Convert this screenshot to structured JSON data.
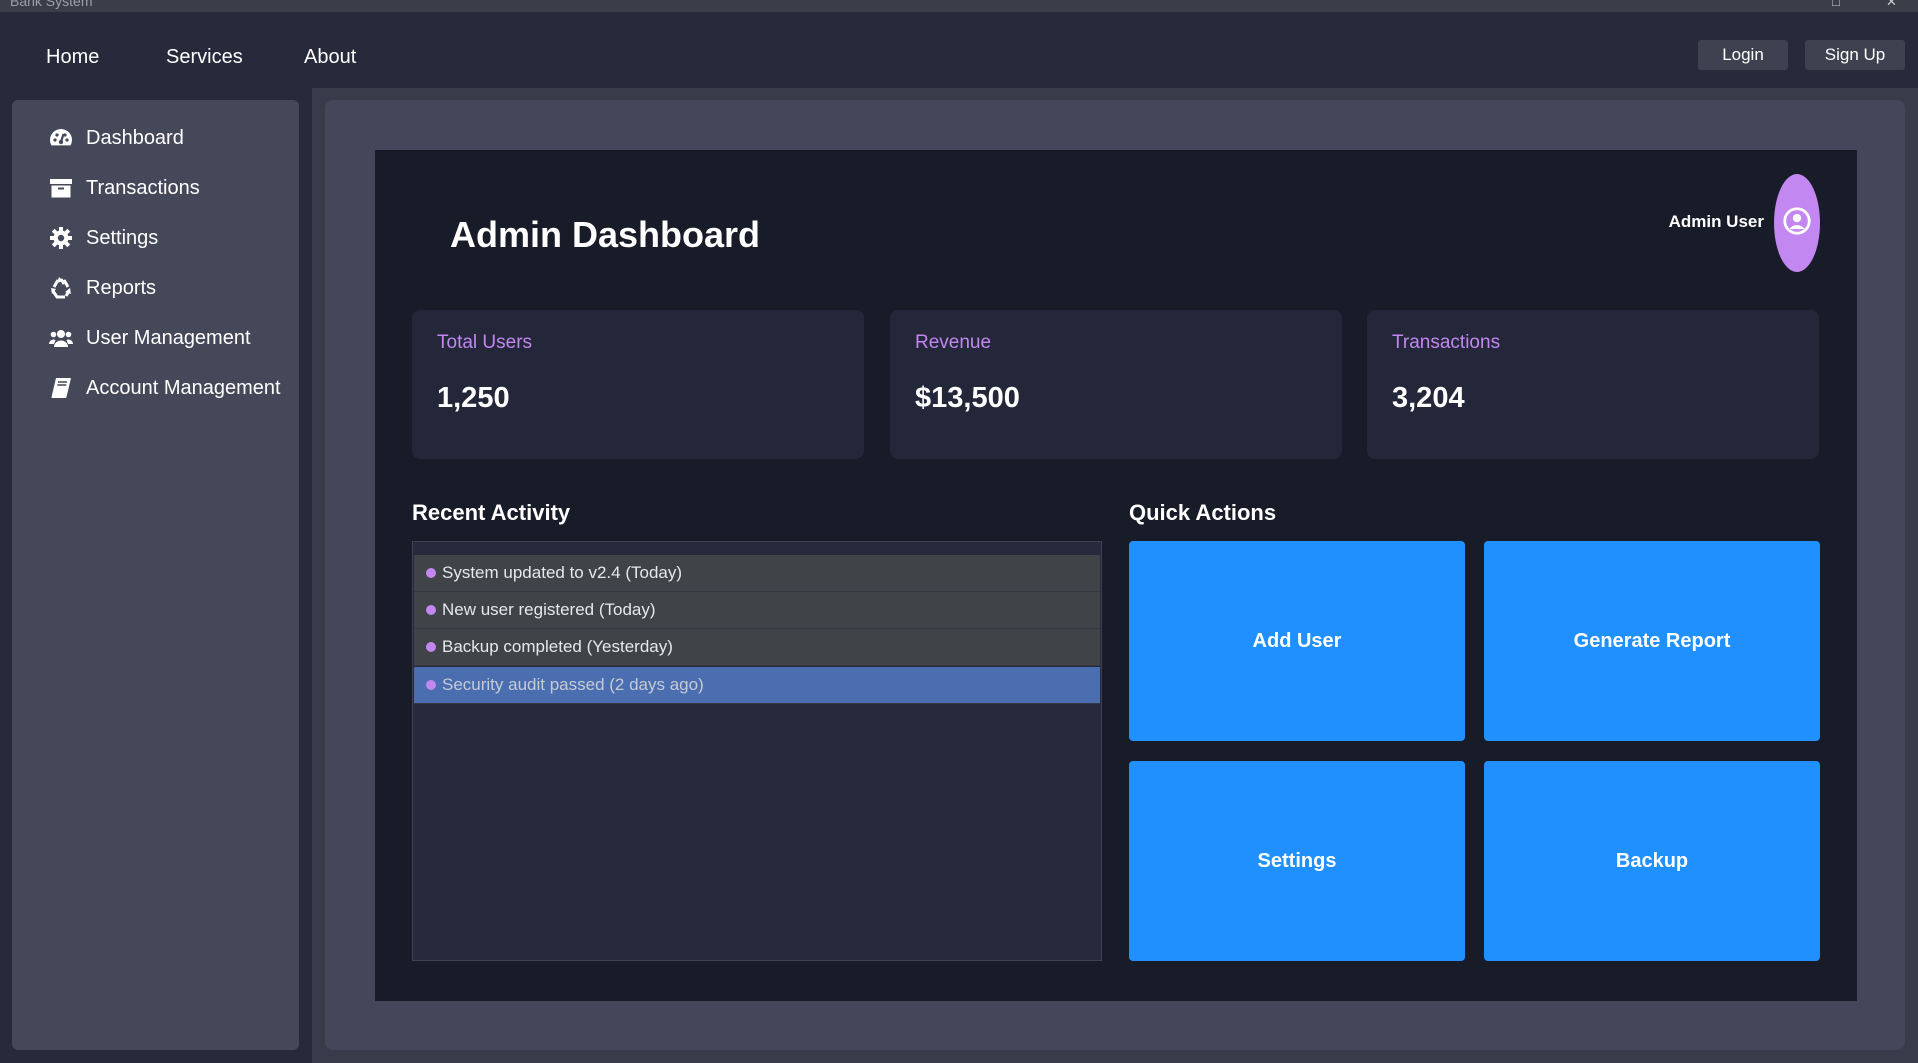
{
  "window": {
    "title": "Bank System"
  },
  "nav": {
    "links": [
      "Home",
      "Services",
      "About"
    ],
    "login": "Login",
    "signup": "Sign Up"
  },
  "sidebar": {
    "items": [
      {
        "label": "Dashboard",
        "icon": "dashboard-icon"
      },
      {
        "label": "Transactions",
        "icon": "archive-icon"
      },
      {
        "label": "Settings",
        "icon": "gear-icon"
      },
      {
        "label": "Reports",
        "icon": "recycle-icon"
      },
      {
        "label": "User Management",
        "icon": "users-icon"
      },
      {
        "label": "Account Management",
        "icon": "book-icon"
      }
    ]
  },
  "dashboard": {
    "title": "Admin Dashboard",
    "user_name": "Admin User",
    "stats": [
      {
        "label": "Total Users",
        "value": "1,250"
      },
      {
        "label": "Revenue",
        "value": "$13,500"
      },
      {
        "label": "Transactions",
        "value": "3,204"
      }
    ],
    "recent_activity": {
      "title": "Recent Activity",
      "items": [
        "System updated to v2.4 (Today)",
        "New user registered (Today)",
        "Backup completed (Yesterday)",
        "Security audit passed (2 days ago)"
      ],
      "selected_index": 3
    },
    "quick_actions": {
      "title": "Quick Actions",
      "buttons": [
        "Add User",
        "Generate Report",
        "Settings",
        "Backup"
      ]
    }
  },
  "colors": {
    "accent_purple": "#c287f0",
    "action_blue": "#1f90fd",
    "selection_blue": "#4a6eb0"
  }
}
